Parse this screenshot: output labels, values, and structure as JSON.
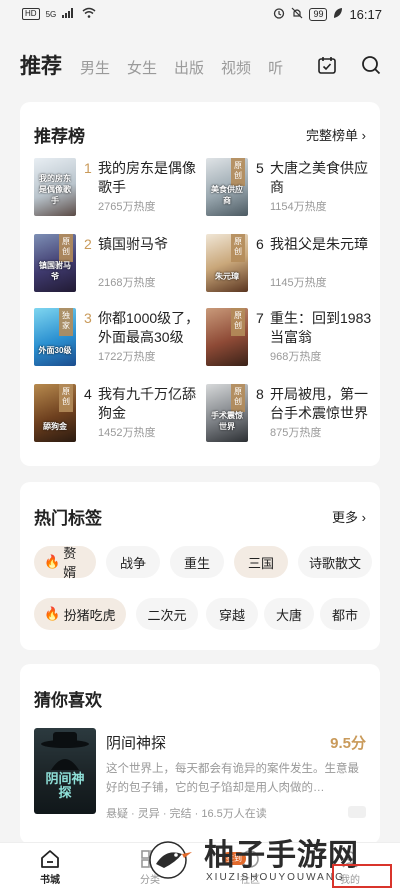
{
  "status_bar": {
    "left_badge": "HD",
    "network": "5G",
    "battery": "99",
    "time": "16:17"
  },
  "top_tabs": [
    "推荐",
    "男生",
    "女生",
    "出版",
    "视频",
    "听"
  ],
  "ranking": {
    "title": "推荐榜",
    "more_label": "完整榜单 ›",
    "items": [
      {
        "rank": "1",
        "title": "我的房东是偶像歌手",
        "heat": "2765万热度",
        "ribbon": "",
        "cover_text": "我的房东是偶像歌手"
      },
      {
        "rank": "2",
        "title": "镇国驸马爷",
        "heat": "2168万热度",
        "ribbon": "原创",
        "cover_text": "镇国驸马爷"
      },
      {
        "rank": "3",
        "title": "你都1000级了，外面最高30级",
        "heat": "1722万热度",
        "ribbon": "独家",
        "cover_text": "外面30级"
      },
      {
        "rank": "4",
        "title": "我有九千万亿舔狗金",
        "heat": "1452万热度",
        "ribbon": "原创",
        "cover_text": "舔狗金"
      },
      {
        "rank": "5",
        "title": "大唐之美食供应商",
        "heat": "1154万热度",
        "ribbon": "原创",
        "cover_text": "美食供应商"
      },
      {
        "rank": "6",
        "title": "我祖父是朱元璋",
        "heat": "1145万热度",
        "ribbon": "原创",
        "cover_text": "朱元璋"
      },
      {
        "rank": "7",
        "title": "重生：回到1983当富翁",
        "heat": "968万热度",
        "ribbon": "原创",
        "cover_text": ""
      },
      {
        "rank": "8",
        "title": "开局被甩，第一台手术震惊世界",
        "heat": "875万热度",
        "ribbon": "原创",
        "cover_text": "手术震惊世界"
      }
    ]
  },
  "tags": {
    "title": "热门标签",
    "more_label": "更多 ›",
    "row1": [
      "赘婿",
      "战争",
      "重生",
      "三国",
      "诗歌散文"
    ],
    "row2": [
      "扮猪吃虎",
      "二次元",
      "穿越",
      "大唐",
      "都市"
    ]
  },
  "guess": {
    "title": "猜你喜欢",
    "book_title": "阴间神探",
    "score": "9.5分",
    "cover_text": "阴间神探",
    "description": "这个世界上，每天都会有诡异的案件发生。生意最好的包子铺，它的包子馅却是用人肉做的…",
    "meta": "悬疑 · 灵异 · 完结 · 16.5万人在读"
  },
  "bottom_nav": {
    "items": [
      {
        "label": "书城",
        "icon": "home-icon"
      },
      {
        "label": "分类",
        "icon": "grid-icon"
      },
      {
        "label": "社区",
        "icon": "community-icon"
      },
      {
        "label": "我的",
        "icon": "profile-icon"
      }
    ]
  },
  "watermark": {
    "main": "柚子手游网",
    "sub": "XIUZISHOUYOUWANG",
    "stamp": "签到"
  },
  "colors": {
    "accent": "#c99a5a",
    "fire": "#e46b2d",
    "background": "#f4f4f4"
  }
}
